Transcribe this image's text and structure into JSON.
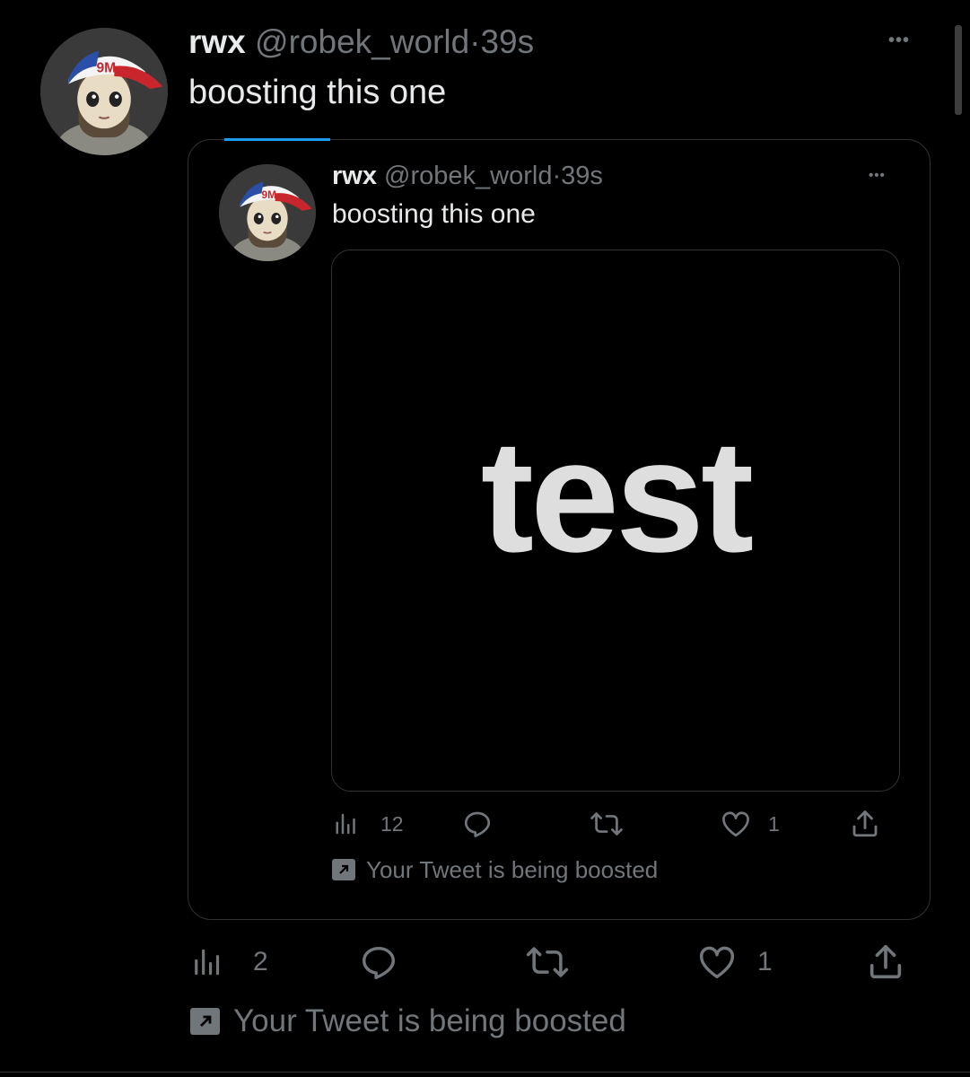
{
  "tweet": {
    "display_name": "rwx",
    "handle": "@robek_world",
    "separator": "·",
    "time": "39s",
    "text": "boosting this one",
    "more_label": "•••",
    "stats": {
      "views": "2",
      "likes": "1"
    },
    "boost_note": "Your Tweet is being boosted"
  },
  "quoted": {
    "display_name": "rwx",
    "handle": "@robek_world",
    "separator": "·",
    "time": "39s",
    "text": "boosting this one",
    "more_label": "•••",
    "media_text": "test",
    "stats": {
      "views": "12",
      "likes": "1"
    },
    "boost_note": "Your Tweet is being boosted"
  },
  "avatar": {
    "cap_text": "9M"
  },
  "colors": {
    "background": "#000000",
    "text": "#e7e9ea",
    "muted": "#71767b",
    "border": "#2f3336",
    "accent": "#1d9bf0"
  },
  "icons": [
    "views-icon",
    "reply-icon",
    "retweet-icon",
    "like-icon",
    "share-icon",
    "boost-arrow-icon",
    "more-icon"
  ]
}
